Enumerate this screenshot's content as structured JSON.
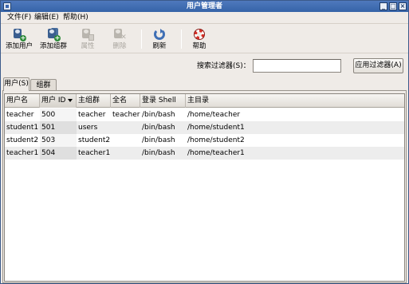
{
  "window": {
    "title": "用户管理者"
  },
  "menu": [
    "文件(F)",
    "编辑(E)",
    "帮助(H)"
  ],
  "toolbar": {
    "add_user": "添加用户",
    "add_group": "添加组群",
    "properties": "属性",
    "delete": "删除",
    "refresh": "刷新",
    "help": "帮助"
  },
  "search": {
    "label": "搜索过滤器(S)：",
    "value": "",
    "apply": "应用过滤器(A)"
  },
  "tabs": [
    "用户(S)",
    "组群(G)"
  ],
  "table": {
    "columns": [
      "用户名",
      "用户 ID",
      "主组群",
      "全名",
      "登录 Shell",
      "主目录"
    ],
    "sorted_column": "用户 ID",
    "rows": [
      {
        "username": "teacher",
        "uid": "500",
        "group": "teacher",
        "fullname": "teacher",
        "shell": "/bin/bash",
        "home": "/home/teacher"
      },
      {
        "username": "student1",
        "uid": "501",
        "group": "users",
        "fullname": "",
        "shell": "/bin/bash",
        "home": "/home/student1"
      },
      {
        "username": "student2",
        "uid": "503",
        "group": "student2",
        "fullname": "",
        "shell": "/bin/bash",
        "home": "/home/student2"
      },
      {
        "username": "teacher1",
        "uid": "504",
        "group": "teacher1",
        "fullname": "",
        "shell": "/bin/bash",
        "home": "/home/teacher1"
      }
    ]
  },
  "colors": {
    "titlebar": "#3a66ad",
    "window_bg": "#efebe7",
    "alt_row": "#ededed"
  }
}
